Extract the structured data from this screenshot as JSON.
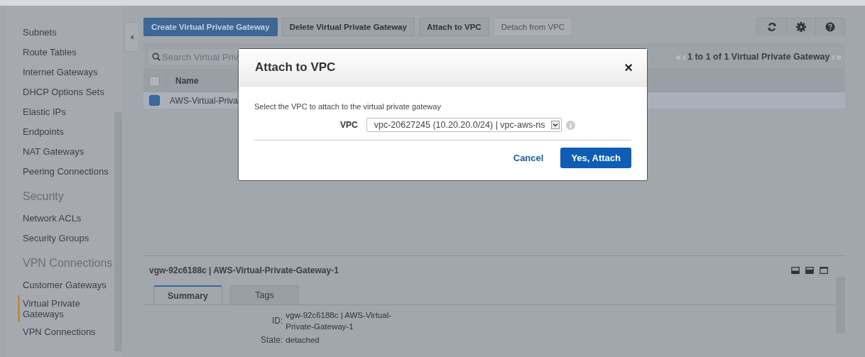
{
  "sidebar": {
    "sections": [
      {
        "items": [
          {
            "label": "Subnets",
            "selected": false
          },
          {
            "label": "Route Tables",
            "selected": false
          },
          {
            "label": "Internet Gateways",
            "selected": false
          },
          {
            "label": "DHCP Options Sets",
            "selected": false
          },
          {
            "label": "Elastic IPs",
            "selected": false
          },
          {
            "label": "Endpoints",
            "selected": false
          },
          {
            "label": "NAT Gateways",
            "selected": false
          },
          {
            "label": "Peering Connections",
            "selected": false
          }
        ]
      },
      {
        "heading": "Security",
        "items": [
          {
            "label": "Network ACLs",
            "selected": false
          },
          {
            "label": "Security Groups",
            "selected": false
          }
        ]
      },
      {
        "heading": "VPN Connections",
        "items": [
          {
            "label": "Customer Gateways",
            "selected": false
          },
          {
            "label": "Virtual Private Gateways",
            "selected": true
          },
          {
            "label": "VPN Connections",
            "selected": false
          }
        ]
      }
    ]
  },
  "toolbar": {
    "buttons": [
      {
        "label": "Create Virtual Private Gateway",
        "kind": "primary",
        "disabled": false
      },
      {
        "label": "Delete Virtual Private Gateway",
        "kind": "default",
        "disabled": false
      },
      {
        "label": "Attach to VPC",
        "kind": "default",
        "disabled": false
      },
      {
        "label": "Detach from VPC",
        "kind": "default",
        "disabled": true
      }
    ],
    "icon_buttons": [
      {
        "kind": "refresh"
      },
      {
        "kind": "settings"
      },
      {
        "kind": "help"
      }
    ]
  },
  "table": {
    "search": {
      "placeholder": "Search Virtual Priv"
    },
    "pagination": {
      "first": "«",
      "previous": "‹",
      "text": "1 to 1 of 1 Virtual Private Gateway",
      "next": "›",
      "last": "»"
    },
    "all_selected": false,
    "columns": [
      "Name"
    ],
    "rows": [
      {
        "cells": [
          "AWS-Virtual-Priva"
        ],
        "selected": true
      }
    ]
  },
  "details": {
    "title": "vgw-92c6188c | AWS-Virtual-Private-Gateway-1",
    "tabs": [
      {
        "label": "Summary",
        "selected": true
      },
      {
        "label": "Tags",
        "selected": false
      }
    ],
    "fields": [
      {
        "label": "ID:",
        "value": "vgw-92c6188c | AWS-Virtual-Private-Gateway-1"
      },
      {
        "label": "State:",
        "value": "detached"
      }
    ]
  },
  "dialog": {
    "title": "Attach to VPC",
    "close": "×",
    "message": "Select the VPC to attach to the virtual private gateway",
    "field_label": "VPC",
    "value": "vpc-20627245 (10.20.20.0/24) | vpc-aws-ns",
    "buttons": [
      {
        "label": "Cancel",
        "kind": "link"
      },
      {
        "label": "Yes, Attach",
        "kind": "primary"
      }
    ]
  }
}
